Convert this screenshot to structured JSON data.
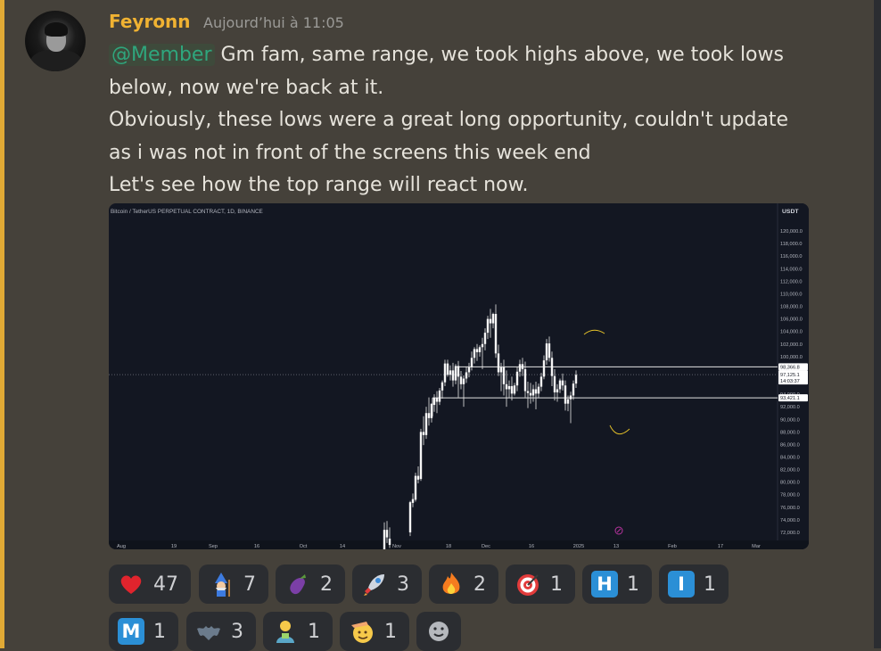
{
  "message": {
    "author": "Feyronn",
    "timestamp": "Aujourd’hui à 11:05",
    "mention": "@Member",
    "lines": [
      "Gm fam, same range, we took highs above, we took lows",
      "below, now we're back at it.",
      "Obviously, these lows were a great long opportunity, couldn't update",
      "as i was not in front of the screens this week  end",
      "Let's see how the top range will react now."
    ],
    "accent_color": "#f0b232"
  },
  "chart_data": {
    "type": "candlestick",
    "title": "Bitcoin / TetherUS PERPETUAL CONTRACT, 1D, BINANCE",
    "currency": "USDT",
    "ylim": [
      71000,
      122000
    ],
    "y_ticks": [
      "120,000.0",
      "118,000.0",
      "116,000.0",
      "114,000.0",
      "112,000.0",
      "110,000.0",
      "108,000.0",
      "106,000.0",
      "104,000.0",
      "102,000.0",
      "100,000.0",
      "98,000.0",
      "96,000.0",
      "94,000.0",
      "92,000.0",
      "90,000.0",
      "88,000.0",
      "86,000.0",
      "84,000.0",
      "82,000.0",
      "80,000.0",
      "78,000.0",
      "76,000.0",
      "74,000.0",
      "72,000.0"
    ],
    "x_ticks": [
      "Aug",
      "19",
      "Sep",
      "16",
      "Oct",
      "14",
      "Nov",
      "18",
      "Dec",
      "16",
      "2025",
      "13",
      "Feb",
      "17",
      "Mar"
    ],
    "price_labels": {
      "resistance": "98,366.8",
      "current": "97,125.1",
      "countdown": "14:03:37",
      "support": "93,421.1"
    },
    "levels": {
      "resistance": 98366.8,
      "current": 97125.1,
      "support": 93421.1
    },
    "colors": {
      "up": "#ffffff",
      "down": "#ffffff",
      "background": "#131722",
      "annotation": "#e6c229"
    }
  },
  "reactions": [
    {
      "icon": "heart-icon",
      "count": "47"
    },
    {
      "icon": "wizard-icon",
      "count": "7"
    },
    {
      "icon": "eggplant-icon",
      "count": "2"
    },
    {
      "icon": "rocket-icon",
      "count": "3"
    },
    {
      "icon": "fire-icon",
      "count": "2"
    },
    {
      "icon": "target-icon",
      "count": "1"
    },
    {
      "icon": "letter-h-icon",
      "count": "1",
      "letter": "H"
    },
    {
      "icon": "letter-i-icon",
      "count": "1",
      "letter": "I"
    },
    {
      "icon": "letter-m-icon",
      "count": "1",
      "letter": "M"
    },
    {
      "icon": "bat-icon",
      "count": "3"
    },
    {
      "icon": "person-icon",
      "count": "1"
    },
    {
      "icon": "saluting-face-icon",
      "count": "1"
    },
    {
      "icon": "add-reaction-icon"
    }
  ]
}
